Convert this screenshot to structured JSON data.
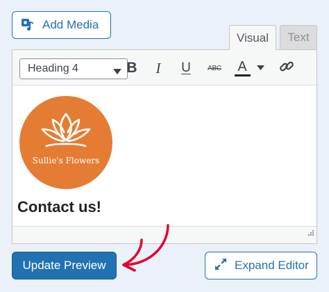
{
  "media": {
    "add_media_label": "Add Media",
    "icon": "media-upload-icon"
  },
  "editor": {
    "tabs": [
      {
        "label": "Visual",
        "active": true
      },
      {
        "label": "Text",
        "active": false
      }
    ],
    "toolbar": {
      "format_select": "Heading 4",
      "bold_label": "B",
      "italic_label": "I",
      "underline_label": "U",
      "strikethrough_label": "ABC",
      "text_color_label": "A",
      "link_icon": "link-icon"
    },
    "content": {
      "logo_text": "Sullie's Flowers",
      "heading": "Contact us!"
    }
  },
  "actions": {
    "update_preview_label": "Update Preview",
    "expand_editor_label": "Expand Editor",
    "expand_icon": "expand-arrows-icon"
  },
  "colors": {
    "primary": "#2271b1",
    "logo_orange": "#e47d33",
    "annotation_red": "#e5002e",
    "page_background": "#eaf1f9"
  }
}
